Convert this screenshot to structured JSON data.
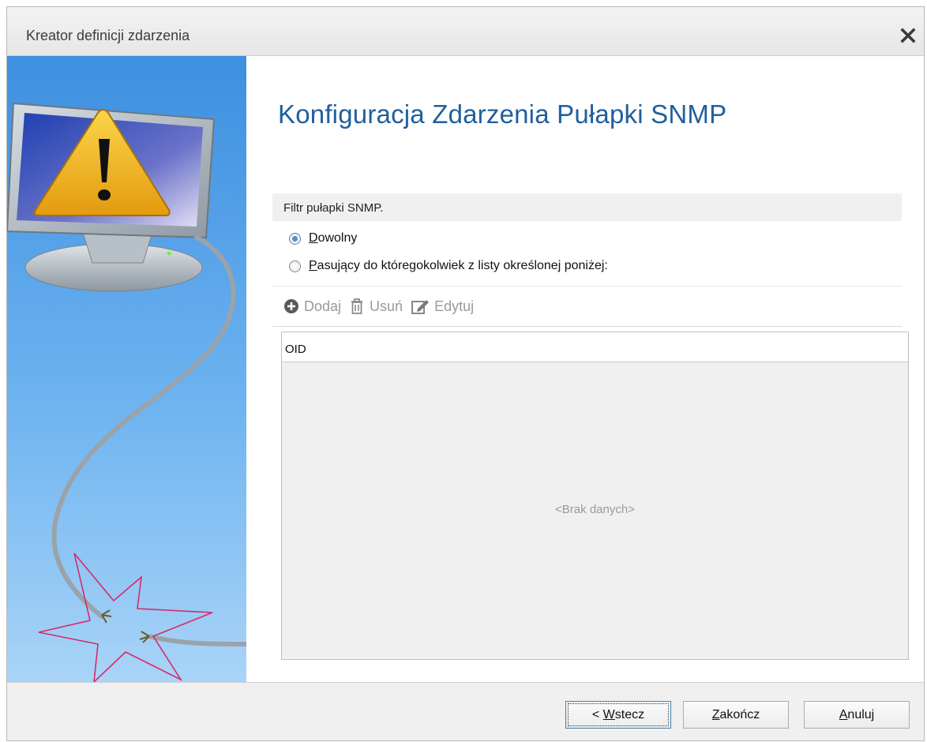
{
  "window": {
    "title": "Kreator definicji zdarzenia",
    "close_icon": "close-icon"
  },
  "page": {
    "title": "Konfiguracja Zdarzenia Pułapki SNMP"
  },
  "filter": {
    "group_label": "Filtr pułapki SNMP.",
    "options": [
      {
        "label": "Dowolny",
        "selected": true
      },
      {
        "label": "Pasujący do któregokolwiek z listy określonej poniżej:",
        "selected": false
      }
    ]
  },
  "toolbar": {
    "add_label": "Dodaj",
    "delete_label": "Usuń",
    "edit_label": "Edytuj"
  },
  "grid": {
    "columns": [
      "OID"
    ],
    "empty_text": "<Brak danych>"
  },
  "footer": {
    "back_prefix": "< ",
    "back_mnemonic": "W",
    "back_rest": "stecz",
    "finish_mnemonic": "Z",
    "finish_rest": "akończ",
    "cancel_mnemonic": "A",
    "cancel_rest": "nuluj"
  },
  "colors": {
    "title_blue": "#1f5f9e",
    "side_panel_blue": "#5aa3e8",
    "warning_yellow": "#f2b51a"
  }
}
